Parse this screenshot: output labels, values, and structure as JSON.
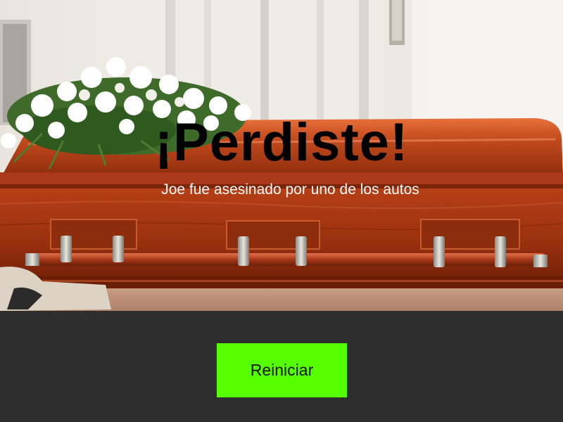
{
  "game_over": {
    "title": "¡Perdiste!",
    "message": "Joe fue asesinado por uno de los autos"
  },
  "controls": {
    "restart_label": "Reiniciar"
  },
  "colors": {
    "background": "#2e2e2e",
    "restart_button": "#55ff00",
    "title_text": "#000000",
    "message_text": "#ffffff"
  },
  "scene": {
    "image_subject": "casket-with-flowers"
  }
}
